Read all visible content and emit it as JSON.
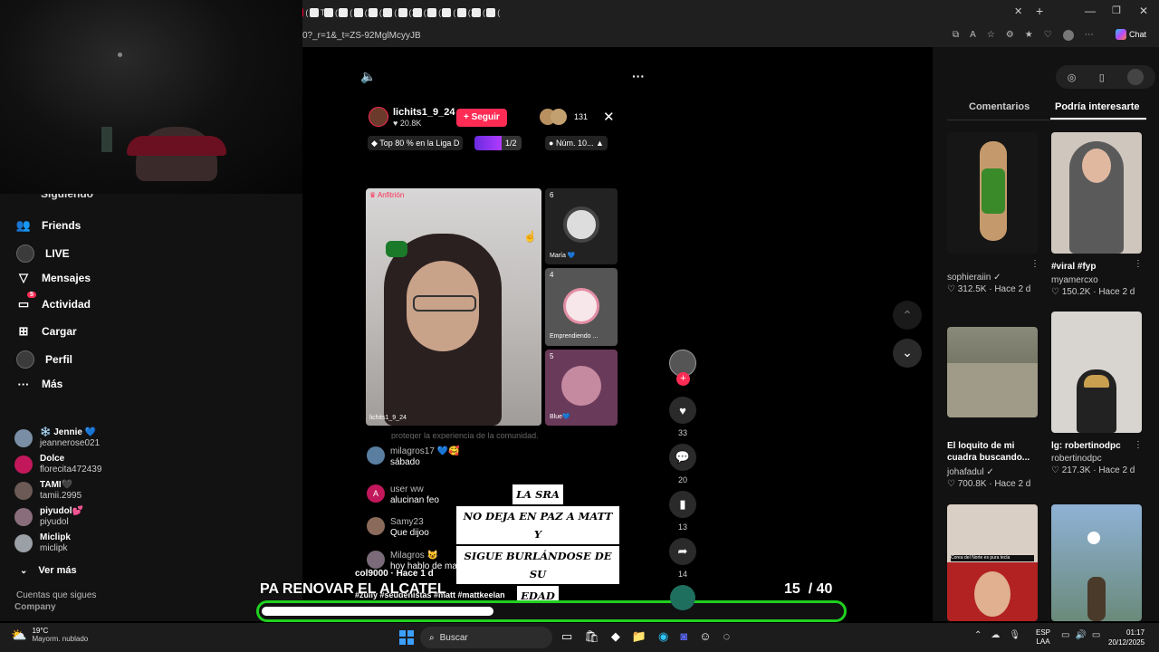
{
  "browser": {
    "tabs": [
      {
        "label": "Str",
        "color": "#53fc18"
      },
      {
        "label": "Nu",
        "color": "#888888"
      },
      {
        "label": "En",
        "color": "#53fc18"
      },
      {
        "label": "ZU",
        "color": "#53fc18"
      },
      {
        "label": "Da",
        "color": "#53fc18"
      },
      {
        "label": "Ins",
        "color": "#d62976"
      },
      {
        "label": "Nu",
        "color": "#888888"
      },
      {
        "label": "(15",
        "color": "#fe2c55"
      },
      {
        "label": "(15",
        "color": "#fe2c55"
      },
      {
        "label": "(15",
        "color": "#eeeeee"
      },
      {
        "label": "En",
        "color": "#eeeeee"
      },
      {
        "label": "(16",
        "color": "#eeeeee"
      },
      {
        "label": "(16",
        "color": "#eeeeee"
      },
      {
        "label": "(16",
        "color": "#eeeeee"
      },
      {
        "label": "(16",
        "color": "#eeeeee"
      },
      {
        "label": "(16",
        "color": "#eeeeee"
      },
      {
        "label": "(16",
        "color": "#eeeeee"
      },
      {
        "label": "(16",
        "color": "#eeeeee"
      },
      {
        "label": "(15",
        "color": "#ff0033"
      },
      {
        "label": "Tik",
        "color": "#eeeeee"
      },
      {
        "label": "(17",
        "color": "#eeeeee"
      },
      {
        "label": "(17",
        "color": "#eeeeee"
      },
      {
        "label": "(17",
        "color": "#eeeeee"
      },
      {
        "label": "(17",
        "color": "#eeeeee"
      },
      {
        "label": "(17",
        "color": "#eeeeee"
      },
      {
        "label": "(17",
        "color": "#eeeeee"
      },
      {
        "label": "(17",
        "color": "#eeeeee"
      },
      {
        "label": "(18",
        "color": "#eeeeee"
      },
      {
        "label": "(19",
        "color": "#eeeeee"
      },
      {
        "label": "(19",
        "color": "#eeeeee"
      },
      {
        "label": "(19",
        "color": "#eeeeee"
      },
      {
        "label": "(19",
        "color": "#eeeeee"
      }
    ],
    "url": "0?_r=1&_t=ZS-92MglMcyyJB",
    "chat_label": "Chat"
  },
  "sidebar": {
    "partial_top": "Siguiendo",
    "items": [
      {
        "label": "Friends",
        "icon": "friends-icon",
        "glyph": "👥"
      },
      {
        "label": "LIVE",
        "icon": "live-icon",
        "glyph": ""
      },
      {
        "label": "Mensajes",
        "icon": "messages-icon",
        "glyph": "▽"
      },
      {
        "label": "Actividad",
        "icon": "activity-icon",
        "glyph": "▭",
        "badge": "5"
      },
      {
        "label": "Cargar",
        "icon": "upload-icon",
        "glyph": "⊞"
      },
      {
        "label": "Perfil",
        "icon": "profile-icon",
        "glyph": ""
      },
      {
        "label": "Más",
        "icon": "more-icon",
        "glyph": "···"
      }
    ],
    "following_title": "Cuentas que sigues",
    "following": [
      {
        "name": "❄️ Jennie 💙",
        "user": "jeannerose021",
        "color": "#7a8fa6"
      },
      {
        "name": "Dolce",
        "user": "florecita472439",
        "color": "#c2185b"
      },
      {
        "name": "TAMI🖤",
        "user": "tamii.2995",
        "color": "#6b5a55"
      },
      {
        "name": "piyudol💕",
        "user": "piyudol",
        "color": "#8a6d7a"
      },
      {
        "name": "Miclipk",
        "user": "miclipk",
        "color": "#9aa0a6"
      }
    ],
    "see_more": "Ver más",
    "company": "Company"
  },
  "live": {
    "host": "lichits1_9_24",
    "likes": "20.8K",
    "follow_label": "+ Seguir",
    "viewers": "131",
    "rank_label": "Top 80 % en la Liga D",
    "battle": "1/2",
    "num_label": "Núm. 10...",
    "host_tag": "Anfitrión",
    "host_name_tag": "lichits1_9_24",
    "guests": [
      {
        "num": "6",
        "name": "María 💙"
      },
      {
        "num": "4",
        "name": "Emprendiendo ..."
      },
      {
        "num": "5",
        "name": "Blue💙"
      }
    ],
    "partial_line": "proteger la experiencia de la comunidad.",
    "chat": [
      {
        "user": "milagros17 💙🥰",
        "msg": "sábado",
        "color": "#5a7ea0"
      },
      {
        "user": "user ww",
        "msg": "alucinan feo",
        "color": "#c2185b",
        "initial": "A"
      },
      {
        "user": "Samy23",
        "msg": "Que dijoo",
        "color": "#8a6a5a"
      },
      {
        "user": "Milagros 😺",
        "msg": "hoy hablo de matt",
        "color": "#7a6a7a"
      }
    ],
    "caption_lines": [
      "LA SRA",
      "NO DEJA EN PAZ A MATT Y",
      "SIGUE BURLÁNDOSE DE SU",
      "EDAD"
    ],
    "overlay_user": "col9000 · Hace 1 d",
    "hashtags": "#zully #seudenistas #matt #mattkeelan"
  },
  "overlay": {
    "headline": "PA RENOVAR EL ALCATEL",
    "counter": "15  / 40",
    "progress": 0.4
  },
  "actions": [
    {
      "icon": "heart-icon",
      "glyph": "♥",
      "count": "33"
    },
    {
      "icon": "comment-icon",
      "glyph": "💬",
      "count": "20"
    },
    {
      "icon": "bookmark-icon",
      "glyph": "▮",
      "count": "13"
    },
    {
      "icon": "share-icon",
      "glyph": "➦",
      "count": "14"
    }
  ],
  "rail": {
    "tabs": [
      "Comentarios",
      "Podría interesarte"
    ],
    "cards": [
      {
        "title": "",
        "user": "sophieraiin ✓",
        "likes": "♡ 312.5K · Hace 2 d",
        "color": "#1a1a1a"
      },
      {
        "title": "#viral #fyp",
        "user": "myamercxo",
        "likes": "♡ 150.2K · Hace 2 d",
        "color": "#cfc6bd"
      },
      {
        "title": "",
        "user": "",
        "likes": "",
        "color": "#7a7a6a"
      },
      {
        "title": "",
        "user": "",
        "likes": "",
        "color": "#d8d4d0"
      },
      {
        "title": "El loquito de mi cuadra buscando...",
        "user": "johafadul ✓",
        "likes": "♡ 700.8K · Hace 2 d",
        "color": ""
      },
      {
        "title": "lg: robertinodpc",
        "user": "robertinodpc",
        "likes": "♡ 217.3K · Hace 2 d",
        "color": ""
      },
      {
        "title": "",
        "user": "",
        "likes": "",
        "color": "#b22222"
      },
      {
        "title": "",
        "user": "",
        "likes": "",
        "color": "#8fa9c7"
      }
    ],
    "card_overlay_text": "Corea del Norte es pura tecla"
  },
  "taskbar": {
    "weather_temp": "19°C",
    "weather_desc": "Mayorm. nublado",
    "search_placeholder": "Buscar",
    "lang1": "ESP",
    "lang2": "LAA",
    "time": "01:17",
    "date": "20/12/2025"
  }
}
